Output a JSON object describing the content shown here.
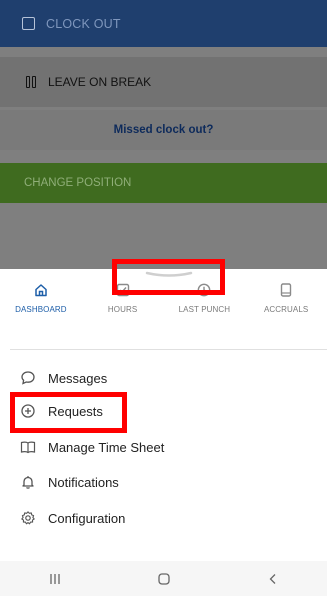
{
  "background_actions": {
    "clock_out": "CLOCK OUT",
    "leave_on_break": "LEAVE ON BREAK",
    "missed_clock_out": "Missed clock out?",
    "change_position": "CHANGE POSITION"
  },
  "tabs": [
    {
      "label": "DASHBOARD",
      "icon": "home-icon",
      "active": true
    },
    {
      "label": "HOURS",
      "icon": "checkbox-icon",
      "active": false
    },
    {
      "label": "LAST PUNCH",
      "icon": "clock-icon",
      "active": false
    },
    {
      "label": "ACCRUALS",
      "icon": "tablet-icon",
      "active": false
    }
  ],
  "menu": [
    {
      "label": "Messages",
      "icon": "message-bubble-icon"
    },
    {
      "label": "Requests",
      "icon": "plus-circle-icon"
    },
    {
      "label": "Manage Time Sheet",
      "icon": "book-icon"
    },
    {
      "label": "Notifications",
      "icon": "bell-icon"
    },
    {
      "label": "Configuration",
      "icon": "gear-icon"
    }
  ],
  "colors": {
    "accent": "#1d5ea8",
    "highlight": "#ff0000",
    "clock_out_bar": "#1f3f6e",
    "change_position_bar": "#3f6b1f"
  }
}
